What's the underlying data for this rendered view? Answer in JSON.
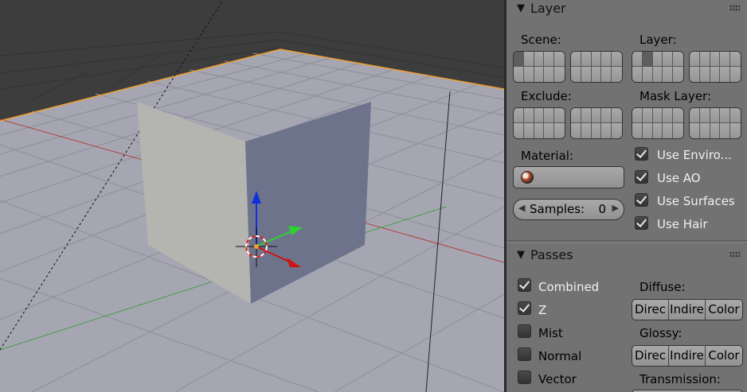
{
  "layer_panel": {
    "title": "Layer",
    "scene_label": "Scene:",
    "layer_label": "Layer:",
    "exclude_label": "Exclude:",
    "mask_layer_label": "Mask Layer:",
    "material_label": "Material:",
    "material_value": "",
    "samples_label": "Samples:",
    "samples_value": "0",
    "use_environment": {
      "label": "Use Enviro...",
      "checked": true
    },
    "use_ao": {
      "label": "Use AO",
      "checked": true
    },
    "use_surfaces": {
      "label": "Use Surfaces",
      "checked": true
    },
    "use_hair": {
      "label": "Use Hair",
      "checked": true
    },
    "scene_layers_active": [
      0
    ],
    "render_layers_active": [
      1
    ]
  },
  "passes_panel": {
    "title": "Passes",
    "combined": {
      "label": "Combined",
      "checked": true
    },
    "z": {
      "label": "Z",
      "checked": true
    },
    "mist": {
      "label": "Mist",
      "checked": false
    },
    "normal": {
      "label": "Normal",
      "checked": false
    },
    "vector": {
      "label": "Vector",
      "checked": false
    },
    "diffuse_label": "Diffuse:",
    "glossy_label": "Glossy:",
    "transmission_label": "Transmission:",
    "diffuse_buttons": [
      "Direc",
      "Indire",
      "Color"
    ],
    "glossy_buttons": [
      "Direc",
      "Indire",
      "Color"
    ]
  },
  "colors": {
    "properties_bg": "#727272",
    "viewport_bg": "#3d3d3d",
    "floor": "#a6a6b3",
    "selection_outline": "#f0a030",
    "x_axis": "#d01010",
    "y_axis": "#30d030",
    "z_axis": "#1030e0"
  }
}
